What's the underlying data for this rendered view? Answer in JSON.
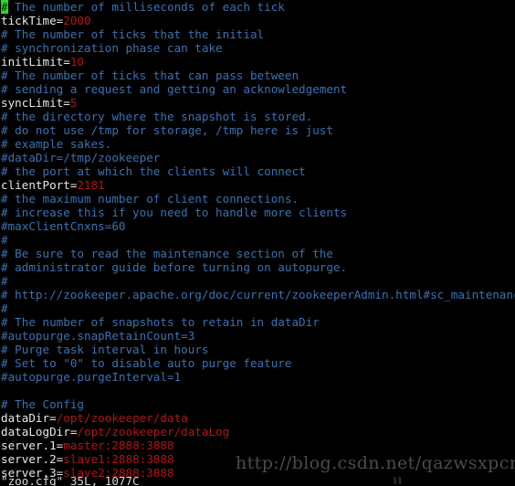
{
  "terminal": {
    "background_color": "#000000",
    "cursor": {
      "glyph": "#",
      "bg_color": "#22dd22",
      "fg_color": "#0a2a0a"
    },
    "colors": {
      "comment": "#3a72b0",
      "key": "#e8e8e8",
      "value": "#b51414",
      "plain": "#cccccc",
      "status": "#d8d8d8"
    }
  },
  "file": {
    "name": "zoo.cfg",
    "lines": [
      {
        "type": "comment",
        "cursor": true,
        "cursor_char": "#",
        "text": " The number of milliseconds of each tick"
      },
      {
        "type": "setting",
        "key": "tickTime=",
        "value": "2000"
      },
      {
        "type": "comment",
        "text": "# The number of ticks that the initial"
      },
      {
        "type": "comment",
        "text": "# synchronization phase can take"
      },
      {
        "type": "setting",
        "key": "initLimit=",
        "value": "10"
      },
      {
        "type": "comment",
        "text": "# The number of ticks that can pass between"
      },
      {
        "type": "comment",
        "text": "# sending a request and getting an acknowledgement"
      },
      {
        "type": "setting",
        "key": "syncLimit=",
        "value": "5"
      },
      {
        "type": "comment",
        "text": "# the directory where the snapshot is stored."
      },
      {
        "type": "comment",
        "text": "# do not use /tmp for storage, /tmp here is just"
      },
      {
        "type": "comment",
        "text": "# example sakes."
      },
      {
        "type": "comment",
        "text": "#dataDir=/tmp/zookeeper"
      },
      {
        "type": "comment",
        "text": "# the port at which the clients will connect"
      },
      {
        "type": "setting",
        "key": "clientPort=",
        "value": "2181"
      },
      {
        "type": "comment",
        "text": "# the maximum number of client connections."
      },
      {
        "type": "comment",
        "text": "# increase this if you need to handle more clients"
      },
      {
        "type": "comment",
        "text": "#maxClientCnxns=60"
      },
      {
        "type": "comment",
        "text": "#"
      },
      {
        "type": "comment",
        "text": "# Be sure to read the maintenance section of the"
      },
      {
        "type": "comment",
        "text": "# administrator guide before turning on autopurge."
      },
      {
        "type": "comment",
        "text": "#"
      },
      {
        "type": "comment",
        "text": "# http://zookeeper.apache.org/doc/current/zookeeperAdmin.html#sc_maintenance"
      },
      {
        "type": "comment",
        "text": "#"
      },
      {
        "type": "comment",
        "text": "# The number of snapshots to retain in dataDir"
      },
      {
        "type": "comment",
        "text": "#autopurge.snapRetainCount=3"
      },
      {
        "type": "comment",
        "text": "# Purge task interval in hours"
      },
      {
        "type": "comment",
        "text": "# Set to \"0\" to disable auto purge feature"
      },
      {
        "type": "comment",
        "text": "#autopurge.purgeInterval=1"
      },
      {
        "type": "blank",
        "text": ""
      },
      {
        "type": "comment",
        "text": "# The Config"
      },
      {
        "type": "setting",
        "key": "dataDir=",
        "value": "/opt/zookeeper/data"
      },
      {
        "type": "setting",
        "key": "dataLogDir=",
        "value": "/opt/zookeeper/dataLog"
      },
      {
        "type": "setting",
        "key": "server.1=",
        "value": "master:2888:3888"
      },
      {
        "type": "setting",
        "key": "server.2=",
        "value": "slave1:2888:3888"
      },
      {
        "type": "setting",
        "key": "server.3=",
        "value": "slave2:2888:3888"
      }
    ]
  },
  "statusline": {
    "text": "\"zoo.cfg\" 35L, 1077C"
  },
  "watermark": {
    "text": "http://blog.csdn.net/qazwsxpcm",
    "sub_text": "ll",
    "color": "#4c4c4c"
  }
}
